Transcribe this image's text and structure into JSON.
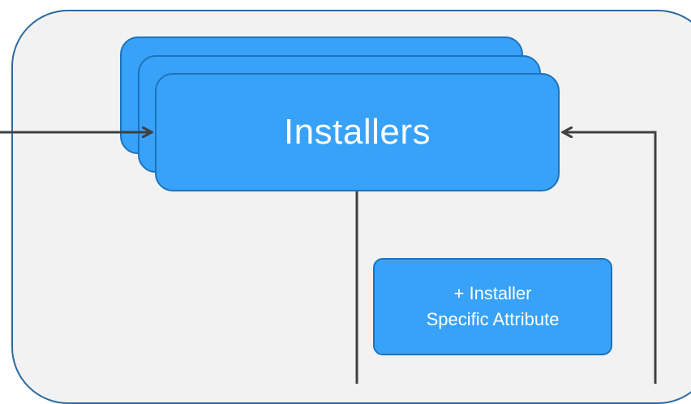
{
  "diagram": {
    "main_box": {
      "label": "Installers"
    },
    "attribute_box": {
      "line1": "+ Installer",
      "line2": "Specific Attribute"
    }
  },
  "colors": {
    "panel_fill": "#f2f2f2",
    "panel_border": "#2c6aa3",
    "box_fill": "#38a1f8",
    "box_border": "#1d73bd",
    "connector": "#404040",
    "text": "#ffffff"
  }
}
